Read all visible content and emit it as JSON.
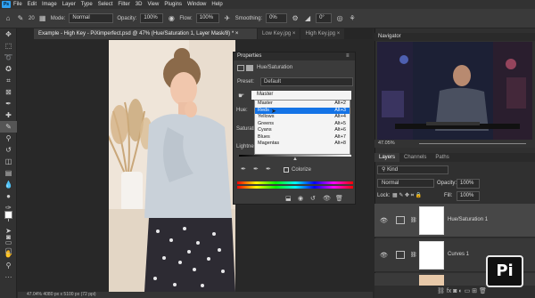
{
  "menu": [
    "File",
    "Edit",
    "Image",
    "Layer",
    "Type",
    "Select",
    "Filter",
    "3D",
    "View",
    "Plugins",
    "Window",
    "Help"
  ],
  "app_logo": "Ps",
  "options": {
    "brush_size": "20",
    "mode_label": "Mode:",
    "mode_value": "Normal",
    "opacity_label": "Opacity:",
    "opacity_value": "100%",
    "flow_label": "Flow:",
    "flow_value": "100%",
    "smoothing_label": "Smoothing:",
    "smoothing_value": "0%",
    "angle_value": "0°"
  },
  "tabs": [
    {
      "label": "Example - High Key - PiXimperfect.psd @ 47% (Hue/Saturation 1, Layer Mask/8) *",
      "close": "×"
    },
    {
      "label": "Low Key.jpg",
      "close": "×"
    },
    {
      "label": "High Key.jpg",
      "close": "×"
    }
  ],
  "status": "47.04%   4080 px x 5100 px (72 ppi)",
  "properties": {
    "title": "Properties",
    "subtitle": "Hue/Saturation",
    "preset_label": "Preset:",
    "preset_value": "Default",
    "channel_value": "Master",
    "hue_label": "Hue:",
    "saturation_label": "Saturation:",
    "lightness_label": "Lightness:",
    "colorize_label": "Colorize",
    "dropdown": [
      {
        "label": "Master",
        "shortcut": "Alt+2"
      },
      {
        "label": "Reds",
        "shortcut": "Alt+3"
      },
      {
        "label": "Yellows",
        "shortcut": "Alt+4"
      },
      {
        "label": "Greens",
        "shortcut": "Alt+5"
      },
      {
        "label": "Cyans",
        "shortcut": "Alt+6"
      },
      {
        "label": "Blues",
        "shortcut": "Alt+7"
      },
      {
        "label": "Magentas",
        "shortcut": "Alt+8"
      }
    ]
  },
  "navigator": {
    "title": "Navigator",
    "zoom": "47.05%"
  },
  "layers_panel": {
    "tabs": [
      "Layers",
      "Channels",
      "Paths"
    ],
    "kind_label": "Kind",
    "blend_mode": "Normal",
    "opacity_label": "Opacity:",
    "opacity_value": "100%",
    "lock_label": "Lock:",
    "fill_label": "Fill:",
    "fill_value": "100%",
    "layers": [
      {
        "name": "Hue/Saturation 1"
      },
      {
        "name": "Curves 1"
      }
    ]
  },
  "watermark": "Pi"
}
